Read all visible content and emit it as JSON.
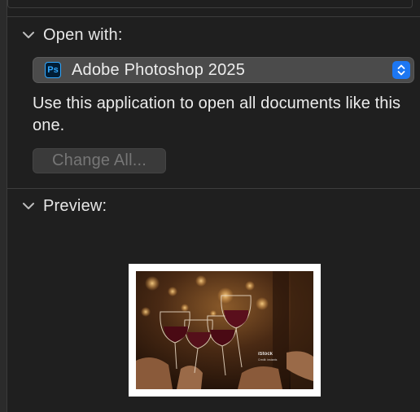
{
  "open_with": {
    "title": "Open with:",
    "app_name": "Adobe Photoshop 2025",
    "app_icon": "photoshop-icon",
    "app_icon_text": "Ps",
    "description": "Use this application to open all documents like this one.",
    "change_all_label": "Change All..."
  },
  "preview": {
    "title": "Preview:",
    "watermark": "iStock",
    "watermark_sub": "Credit: instants"
  },
  "colors": {
    "background": "#1f1f1f",
    "popup": "#4b4b4b",
    "stepper": "#1d77f2",
    "disabled_text": "#767676"
  }
}
